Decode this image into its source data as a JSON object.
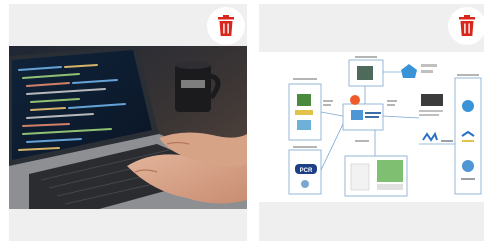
{
  "cards": [
    {
      "image": "laptop-code-photo",
      "delete_icon": "trash-icon",
      "accent": "#d9261c"
    },
    {
      "image": "process-flow-diagram",
      "delete_icon": "trash-icon",
      "accent": "#d9261c",
      "diagram_labels": [
        "PCR"
      ]
    }
  ]
}
